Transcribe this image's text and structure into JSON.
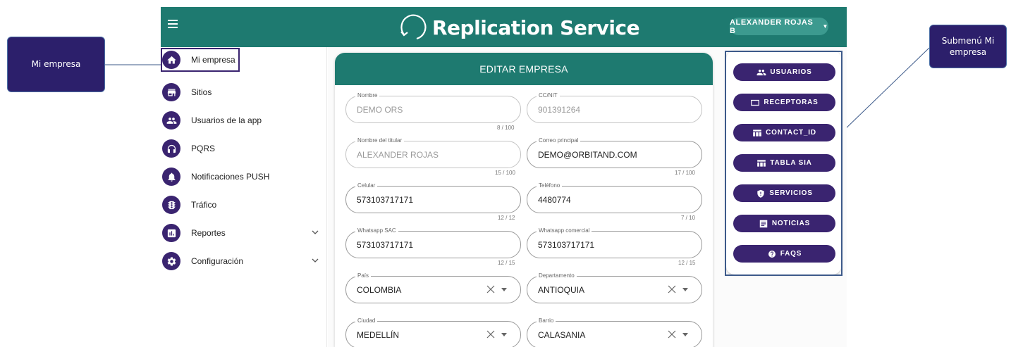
{
  "annotations": {
    "left_label": "Mi empresa",
    "right_label": "Submenú Mi empresa"
  },
  "app": {
    "title": "Replication Service",
    "user_name": "ALEXANDER ROJAS B",
    "user_caret": "▼",
    "colors": {
      "primary": "#1e7a70",
      "accent": "#3a2470"
    }
  },
  "sidebar": {
    "items": [
      {
        "label": "Mi empresa",
        "icon": "home-icon",
        "active": true
      },
      {
        "label": "Sitios",
        "icon": "store-icon"
      },
      {
        "label": "Usuarios de la app",
        "icon": "people-icon"
      },
      {
        "label": "PQRS",
        "icon": "headset-icon"
      },
      {
        "label": "Notificaciones PUSH",
        "icon": "bell-icon"
      },
      {
        "label": "Tráfico",
        "icon": "traffic-light-icon"
      },
      {
        "label": "Reportes",
        "icon": "report-icon",
        "expandable": true
      },
      {
        "label": "Configuración",
        "icon": "gear-icon",
        "expandable": true
      }
    ]
  },
  "form": {
    "title": "EDITAR EMPRESA",
    "fields": {
      "nombre": {
        "label": "Nombre",
        "value": "DEMO ORS",
        "counter": "8 / 100",
        "disabled": true
      },
      "nit": {
        "label": "CC/NIT",
        "value": "901391264",
        "disabled": true
      },
      "titular": {
        "label": "Nombre del titular",
        "value": "ALEXANDER ROJAS",
        "counter": "15 / 100",
        "disabled": true
      },
      "correo": {
        "label": "Correo principal",
        "value": "DEMO@ORBITAND.COM",
        "counter": "17 / 100"
      },
      "celular": {
        "label": "Celular",
        "value": "573103717171",
        "counter": "12 / 12"
      },
      "telefono": {
        "label": "Teléfono",
        "value": "4480774",
        "counter": "7 / 10"
      },
      "whatsapp_sac": {
        "label": "Whatsapp SAC",
        "value": "573103717171",
        "counter": "12 / 15"
      },
      "whatsapp_comercial": {
        "label": "Whatsapp comercial",
        "value": "573103717171",
        "counter": "12 / 15"
      },
      "pais": {
        "label": "País",
        "value": "COLOMBIA"
      },
      "departamento": {
        "label": "Departamento",
        "value": "ANTIOQUIA"
      },
      "ciudad": {
        "label": "Ciudad",
        "value": "MEDELLÍN"
      },
      "barrio": {
        "label": "Barrio",
        "value": "CALASANIA"
      }
    }
  },
  "submenu": {
    "buttons": [
      {
        "label": "USUARIOS",
        "icon": "people-icon"
      },
      {
        "label": "RECEPTORAS",
        "icon": "monitor-icon"
      },
      {
        "label": "CONTACT_ID",
        "icon": "table-icon"
      },
      {
        "label": "TABLA SIA",
        "icon": "table-icon"
      },
      {
        "label": "SERVICIOS",
        "icon": "shield-alert-icon"
      },
      {
        "label": "NOTICIAS",
        "icon": "article-icon"
      },
      {
        "label": "FAQS",
        "icon": "help-icon"
      }
    ]
  }
}
